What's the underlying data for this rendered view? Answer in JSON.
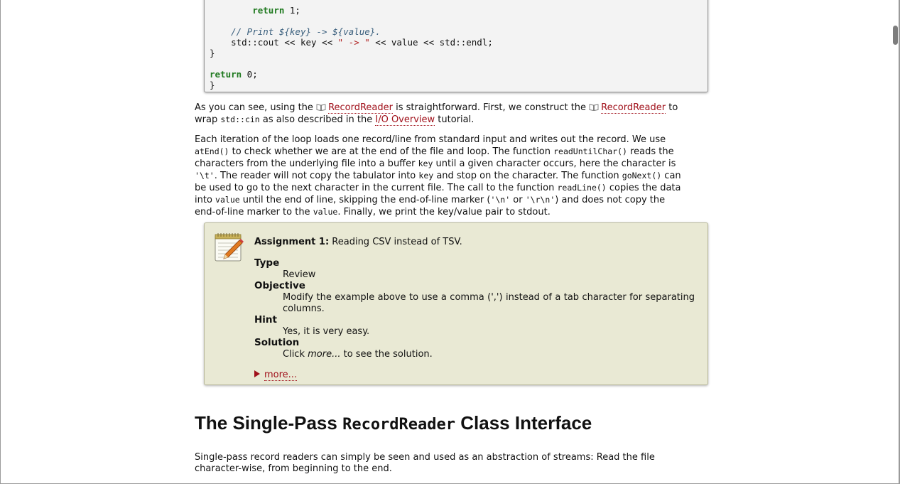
{
  "code": {
    "lines": [
      {
        "indent": "        ",
        "parts": [
          {
            "t": "return",
            "c": "kw"
          },
          {
            "t": " 1;",
            "c": ""
          }
        ]
      },
      {
        "indent": "",
        "parts": []
      },
      {
        "indent": "    ",
        "parts": [
          {
            "t": "// Print ${key} -> ${value}.",
            "c": "cm"
          }
        ]
      },
      {
        "indent": "    ",
        "parts": [
          {
            "t": "std::cout << key << ",
            "c": ""
          },
          {
            "t": "\" -> \"",
            "c": "st"
          },
          {
            "t": " << value << std::endl;",
            "c": ""
          }
        ]
      },
      {
        "indent": "",
        "parts": [
          {
            "t": "}",
            "c": ""
          }
        ]
      },
      {
        "indent": "",
        "parts": []
      },
      {
        "indent": "",
        "parts": [
          {
            "t": "return",
            "c": "kw"
          },
          {
            "t": " 0;",
            "c": ""
          }
        ]
      },
      {
        "indent": "",
        "parts": [
          {
            "t": "}",
            "c": ""
          }
        ]
      }
    ]
  },
  "para1": {
    "t1": "As you can see, using the ",
    "link1": "RecordReader",
    "t2": " is straightforward. First, we construct the ",
    "link2": "RecordReader",
    "t3": " to",
    "t4": "wrap ",
    "code1": "std::cin",
    "t5": " as also described in the ",
    "link3": "I/O Overview",
    "t6": " tutorial."
  },
  "para2": {
    "l1a": "Each iteration of the loop loads one record/line from standard input and writes out the record. We use",
    "l2code1": "atEnd()",
    "l2a": " to check whether we are at the end of the file and loop. The function ",
    "l2code2": "readUntilChar()",
    "l2b": " reads the",
    "l3a": "characters from the underlying file into a buffer ",
    "l3code1": "key",
    "l3b": " until a given character occurs, here the character is",
    "l4code1": "'\\t'",
    "l4a": ". The reader will not copy the tabulator into ",
    "l4code2": "key",
    "l4b": " and stop on the character. The function ",
    "l4code3": "goNext()",
    "l4c": " can",
    "l5a": "be used to go to the next character in the current file. The call to the function ",
    "l5code1": "readLine()",
    "l5b": " copies the data",
    "l6a": "into ",
    "l6code1": "value",
    "l6b": " until the end of line, skipping the end-of-line marker (",
    "l6code2": "'\\n'",
    "l6c": " or ",
    "l6code3": "'\\r\\n'",
    "l6d": ") and does not copy the",
    "l7a": "end-of-line marker to the ",
    "l7code1": "value",
    "l7b": ". Finally, we print the key/value pair to stdout."
  },
  "assignment": {
    "title_bold": "Assignment 1:",
    "title_text": " Reading CSV instead of TSV.",
    "type_label": "Type",
    "type_value": "Review",
    "objective_label": "Objective",
    "objective_value": "Modify the example above to use a comma (',') instead of a tab character for separating columns.",
    "hint_label": "Hint",
    "hint_value": "Yes, it is very easy.",
    "solution_label": "Solution",
    "solution_a": "Click ",
    "solution_em": "more...",
    "solution_b": " to see the solution.",
    "more_label": "more..."
  },
  "heading": {
    "a": "The Single-Pass ",
    "code": "RecordReader",
    "b": " Class Interface"
  },
  "para3": {
    "l1": "Single-pass record readers can simply be seen and used as an abstraction of streams: Read the file",
    "l2": "character-wise, from beginning to the end."
  }
}
